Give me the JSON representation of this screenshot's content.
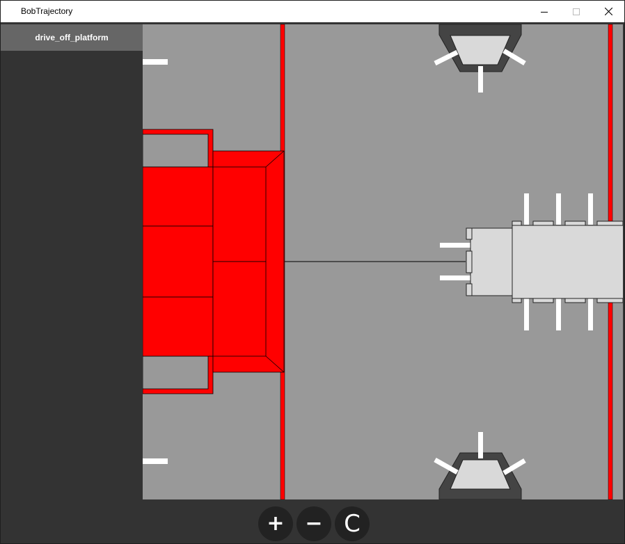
{
  "window": {
    "title": "BobTrajectory",
    "controls": {
      "minimize": "minimize-icon",
      "maximize": "maximize-icon",
      "close": "close-icon"
    }
  },
  "sidebar": {
    "items": [
      {
        "label": "drive_off_platform",
        "selected": true
      }
    ]
  },
  "toolbar": {
    "zoom_in_label": "+",
    "zoom_out_label": "−",
    "center_label": "C"
  },
  "colors": {
    "field": "#999999",
    "platform": "#ff0000",
    "robot": "#d9d9d9",
    "background": "#333333",
    "selected_item": "#666666"
  }
}
